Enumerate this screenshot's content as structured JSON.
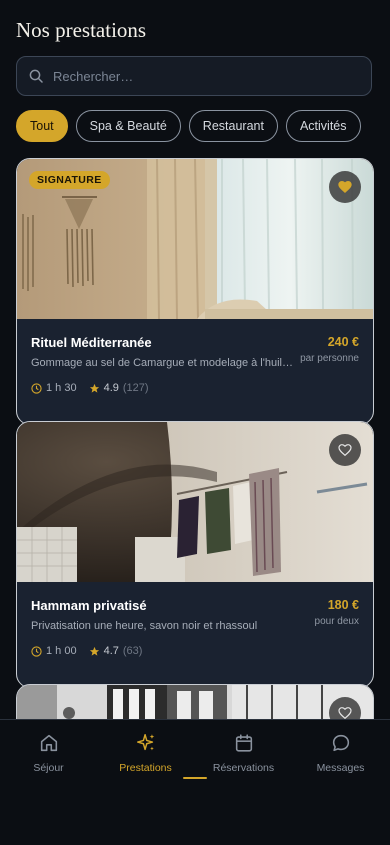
{
  "header": {
    "title": "Nos prestations"
  },
  "search": {
    "placeholder": "Rechercher…",
    "icon": "search-icon"
  },
  "filters": [
    {
      "label": "Tout",
      "active": true
    },
    {
      "label": "Spa & Beauté",
      "active": false
    },
    {
      "label": "Restaurant",
      "active": false
    },
    {
      "label": "Activités",
      "active": false
    }
  ],
  "services": [
    {
      "badge": "SIGNATURE",
      "name": "Rituel Méditerranée",
      "description": "Gommage au sel de Camargue et modelage à l'huile d'olive",
      "price": "240 €",
      "price_unit": "par personne",
      "duration": "1 h 30",
      "rating": "4.9",
      "reviews": "(127)",
      "favorite": true
    },
    {
      "name": "Hammam privatisé",
      "description": "Privatisation une heure, savon noir et rhassoul",
      "price": "180 €",
      "price_unit": "pour deux",
      "duration": "1 h 00",
      "rating": "4.7",
      "reviews": "(63)",
      "favorite": false
    },
    {
      "favorite": false
    }
  ],
  "nav": [
    {
      "label": "Séjour",
      "icon": "home-icon",
      "active": false
    },
    {
      "label": "Prestations",
      "icon": "sparkle-icon",
      "active": true
    },
    {
      "label": "Réservations",
      "icon": "calendar-icon",
      "active": false
    },
    {
      "label": "Messages",
      "icon": "message-icon",
      "active": false
    }
  ],
  "colors": {
    "accent": "#d4a62a",
    "background": "#0b0e13",
    "card": "#1a2230"
  }
}
